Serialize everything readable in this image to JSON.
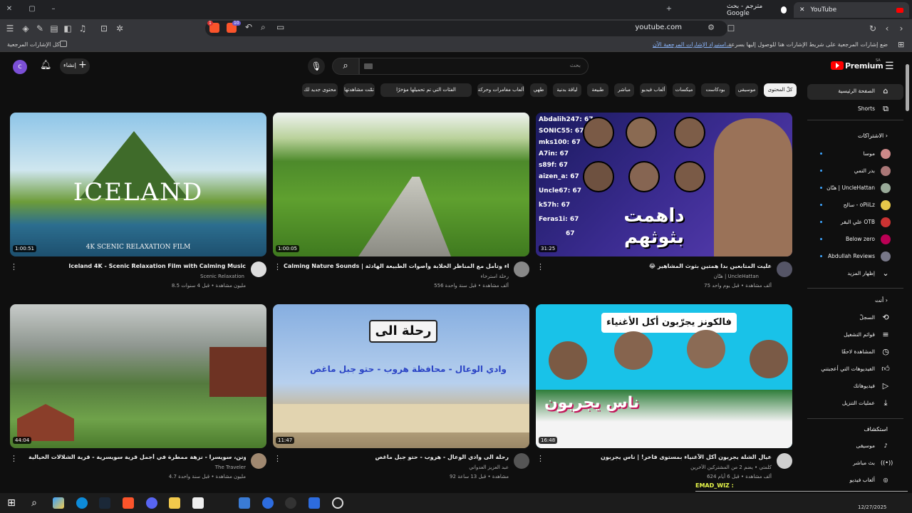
{
  "browser": {
    "tabs": [
      {
        "label": "YouTube",
        "active": true
      },
      {
        "label": "مترجم - بحث Google",
        "active": false
      }
    ],
    "url": "youtube.com",
    "bookmarks_prompt": "ضع إشارات المرجعية على شريط الإشارات هنا للوصول إليها بسرعة.",
    "bookmarks_link": "استيراد الإشارات المرجعية الآن...",
    "all_bookmarks": "كل الإشارات المرجعية",
    "ext_badge_1": "10",
    "ext_badge_2": "1"
  },
  "youtube": {
    "logo": "Premium",
    "logo_region": "SA",
    "create_label": "إنشاء",
    "account_initial": "c",
    "search_placeholder": "بحث",
    "chips": [
      "محتوى جديد لك",
      "تمّت مشاهدتها",
      "الفئات التي تم تحميلها مؤخرًا",
      "ألعاب مغامرات وحركة",
      "طهي",
      "لياقة بدنية",
      "طبيعة",
      "مباشر",
      "ألعاب فيديو",
      "ميكسات",
      "بودكاست",
      "موسيقى",
      "كلّ المحتوى"
    ],
    "active_chip": "كلّ المحتوى"
  },
  "sidebar": {
    "home": "الصفحة الرئيسية",
    "shorts": "Shorts",
    "subscriptions_header": "الاشتراكات",
    "subscriptions": [
      "موسا",
      "بدر التمي",
      "هتّان | UncleHattan",
      "سالح - oPiiLz",
      "علي البقر OTB",
      "Below zero",
      "Abdullah Reviews"
    ],
    "show_more": "إظهار المزيد",
    "you_header": "أنت",
    "you_items": [
      "السجلّ",
      "قوائم التشغيل",
      "المشاهدة لاحقًا",
      "الفيديوهات التي أعجبتني",
      "فيديوهاتك",
      "عمليات التنزيل"
    ],
    "explore_header": "استكشاف",
    "explore_items": [
      "موسيقى",
      "بث مباشر",
      "ألعاب فيديو"
    ]
  },
  "videos": [
    {
      "title": "Iceland 4K - Scenic Relaxation Film with Calming Music",
      "channel": "Scenic Relaxation",
      "meta": "8.5 مليون مشاهدة • قبل 4 سنوات",
      "duration": "1:00:51",
      "thumb_text": "ICELAND",
      "thumb_sub": "4K SCENIC RELAXATION FILM"
    },
    {
      "title": "Calming Nature Sounds | استرخاء وتأمل مع المناظر الخلابة وأصوات الطبيعة الهادئة",
      "channel": "رحلة استرخاء",
      "meta": "556 ألف مشاهدة • قبل سنة واحدة",
      "duration": "1:00:05"
    },
    {
      "title": "😂 عليت المتابعين بدا همتين بثوث المشاهير",
      "channel": "هتّان | UncleHattan",
      "meta": "75 ألف مشاهدة • قبل يوم واحد",
      "duration": "31:25",
      "thumb_text": "داهمت بثوثهم",
      "thumb_names": [
        "Abdalih247: 67",
        "SONIC55: 67",
        "mks100: 67",
        "A7in: 67",
        "s89f: 67",
        "aizen_a: 67",
        "Uncle67: 67",
        "k57h: 67",
        "Feras1i: 67",
        "67"
      ]
    },
    {
      "title": "لوتربرونن، سويسرا - نزهة ممطرة في أجمل قرية سويسرية - قرية الشلالات الخيالية",
      "channel": "The Traveler",
      "meta": "4.7 مليون مشاهدة • قبل سنة واحدة",
      "duration": "44:04"
    },
    {
      "title": "رحلة الى وادي الوعال - هروب - حتو جبل ماغص",
      "channel": "عبد العزيز العدواني",
      "meta": "92 مشاهدة • قبل 13 ساعة",
      "duration": "11:47",
      "thumb_text": "رحلة الى",
      "thumb_sub": "وادي الوعال - محافظة هروب - حتو جبل ماغص"
    },
    {
      "title": "عيال الشلة يجربون أكل الآغنياء بمستوى فاخر! | ناس يجربون",
      "channel": "كلمتي • يضم 2 من المشتركين الآخرين",
      "meta": "624 ألف مشاهدة • قبل 6 أيام",
      "duration": "16:48",
      "thumb_text": "فالكونز يجرّبون أكل الأغنياء",
      "thumb_sub": "ناس يجربون"
    }
  ],
  "overlay_user": "EMAD_WIZ :",
  "taskbar": {
    "date": "12/27/2025"
  }
}
